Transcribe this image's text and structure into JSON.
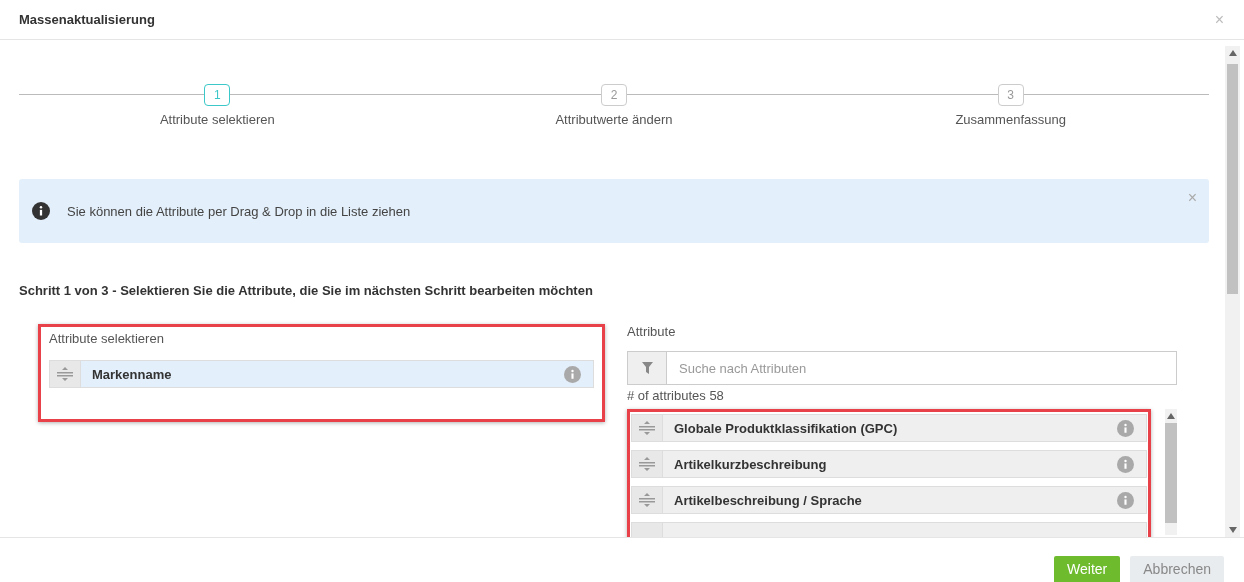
{
  "dialog": {
    "title": "Massenaktualisierung",
    "close": "×"
  },
  "steps": [
    {
      "number": "1",
      "label": "Attribute selektieren",
      "selected": true
    },
    {
      "number": "2",
      "label": "Attributwerte ändern",
      "selected": false
    },
    {
      "number": "3",
      "label": "Zusammenfassung",
      "selected": false
    }
  ],
  "alert": {
    "text": "Sie können die Attribute per Drag & Drop in die Liste ziehen",
    "close": "×"
  },
  "heading": "Schritt 1 von 3 - Selektieren Sie die Attribute, die Sie im nächsten Schritt bearbeiten möchten",
  "selected_panel": {
    "label": "Attribute selektieren",
    "items": [
      {
        "name": "Markenname"
      }
    ]
  },
  "attributes_panel": {
    "label": "Attribute",
    "search": {
      "placeholder": "Suche nach Attributen"
    },
    "count": "# of attributes 58",
    "items": [
      {
        "name": "Globale Produktklassifikation (GPC)"
      },
      {
        "name": "Artikelkurzbeschreibung"
      },
      {
        "name": "Artikelbeschreibung / Sprache"
      }
    ]
  },
  "buttons": [
    {
      "label": "Weiter",
      "kind": "primary"
    },
    {
      "label": "Abbrechen",
      "kind": "secondary"
    }
  ]
}
